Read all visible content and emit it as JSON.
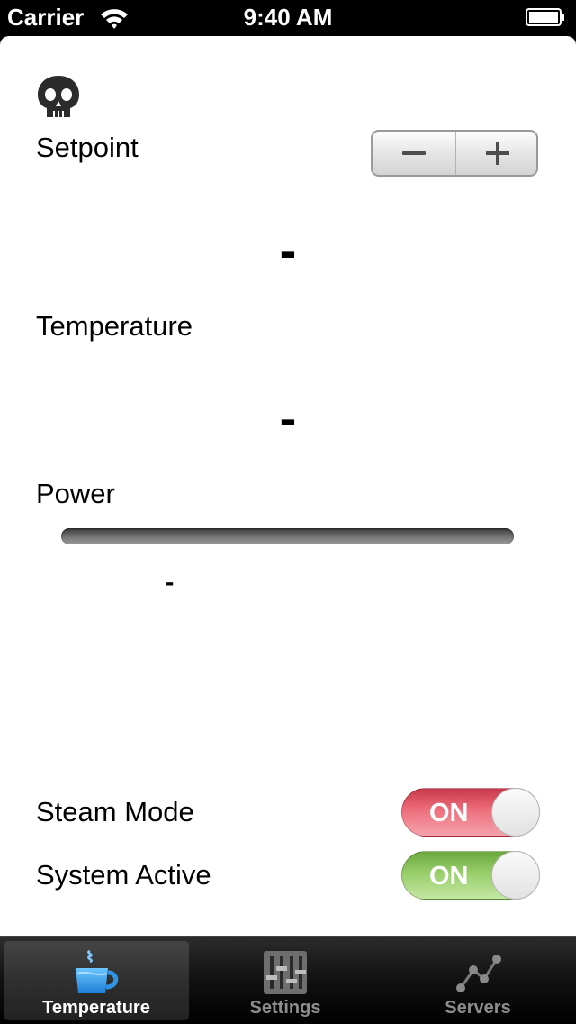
{
  "status_bar": {
    "carrier": "Carrier",
    "time": "9:40 AM"
  },
  "setpoint": {
    "label": "Setpoint",
    "value": "-"
  },
  "temperature": {
    "label": "Temperature",
    "value": "-"
  },
  "power": {
    "label": "Power",
    "percent_text": "-",
    "level": 0
  },
  "steam_mode": {
    "label": "Steam Mode",
    "toggle_text": "ON",
    "color": "#ea6170"
  },
  "system_active": {
    "label": "System Active",
    "toggle_text": "ON",
    "color": "#8cc75d"
  },
  "tab_bar": {
    "tabs": [
      {
        "label": "Temperature",
        "icon": "coffee-cup-icon",
        "selected": true
      },
      {
        "label": "Settings",
        "icon": "sliders-icon",
        "selected": false
      },
      {
        "label": "Servers",
        "icon": "network-graph-icon",
        "selected": false
      }
    ]
  }
}
